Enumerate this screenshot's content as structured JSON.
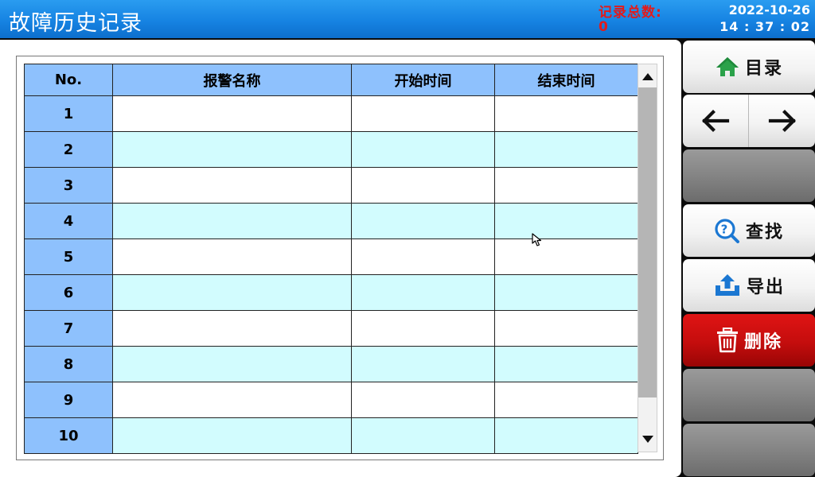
{
  "header": {
    "title": "故障历史记录",
    "record_total_label": "记录总数:",
    "record_total_value": "0",
    "date": "2022-10-26",
    "time": "14 : 37 : 02"
  },
  "table": {
    "columns": [
      "No.",
      "报警名称",
      "开始时间",
      "结束时间"
    ],
    "rows": [
      {
        "no": "1",
        "name": "",
        "start": "",
        "end": ""
      },
      {
        "no": "2",
        "name": "",
        "start": "",
        "end": ""
      },
      {
        "no": "3",
        "name": "",
        "start": "",
        "end": ""
      },
      {
        "no": "4",
        "name": "",
        "start": "",
        "end": ""
      },
      {
        "no": "5",
        "name": "",
        "start": "",
        "end": ""
      },
      {
        "no": "6",
        "name": "",
        "start": "",
        "end": ""
      },
      {
        "no": "7",
        "name": "",
        "start": "",
        "end": ""
      },
      {
        "no": "8",
        "name": "",
        "start": "",
        "end": ""
      },
      {
        "no": "9",
        "name": "",
        "start": "",
        "end": ""
      },
      {
        "no": "10",
        "name": "",
        "start": "",
        "end": ""
      }
    ]
  },
  "sidebar": {
    "menu_label": "目录",
    "prev_icon": "arrow-left-icon",
    "next_icon": "arrow-right-icon",
    "search_label": "查找",
    "export_label": "导出",
    "delete_label": "删除"
  },
  "colors": {
    "header_bg": "#1683e2",
    "table_header_bg": "#8ec1fd",
    "row_alt_bg": "#d2fcfe",
    "alert_red": "#e31a1a",
    "delete_red": "#c40d0d",
    "icon_green": "#2ba24a",
    "icon_blue": "#1b77d2"
  }
}
